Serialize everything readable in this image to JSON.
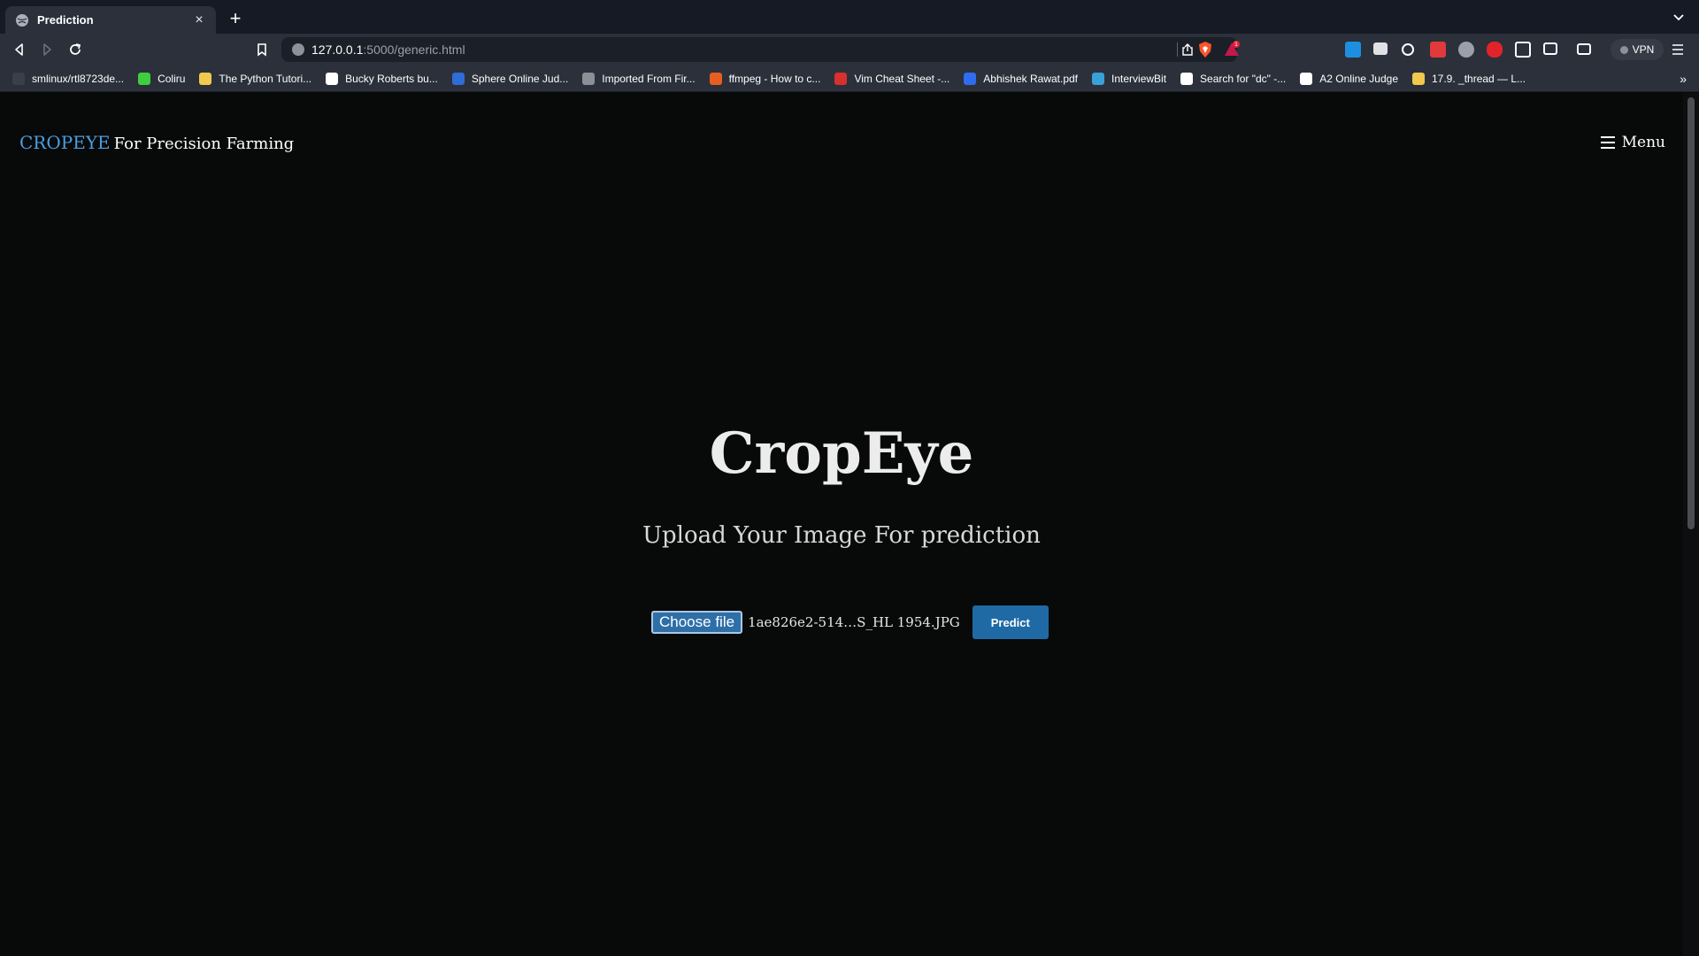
{
  "browser": {
    "tab": {
      "title": "Prediction",
      "favicon": "globe-icon",
      "close_glyph": "×"
    },
    "new_tab_glyph": "+",
    "url": {
      "host": "127.0.0.1",
      "path": ":5000/generic.html"
    },
    "vpn_label": "VPN",
    "bookmarks": [
      {
        "label": "smlinux/rtl8723de...",
        "icon": "github-icon",
        "color": "#3a3f48"
      },
      {
        "label": "Coliru",
        "icon": "coliru-icon",
        "color": "#3ecf3e"
      },
      {
        "label": "The Python Tutori...",
        "icon": "python-icon",
        "color": "#f2c94c"
      },
      {
        "label": "Bucky Roberts bu...",
        "icon": "github-icon",
        "color": "#ffffff"
      },
      {
        "label": "Sphere Online Jud...",
        "icon": "spoj-icon",
        "color": "#2f6cd6"
      },
      {
        "label": "Imported From Fir...",
        "icon": "folder-icon",
        "color": "#8c8f96"
      },
      {
        "label": "ffmpeg - How to c...",
        "icon": "askubuntu-icon",
        "color": "#e85d22"
      },
      {
        "label": "Vim Cheat Sheet -...",
        "icon": "vim-icon",
        "color": "#d92f2f"
      },
      {
        "label": "Abhishek Rawat.pdf",
        "icon": "dropbox-icon",
        "color": "#2f6cf0"
      },
      {
        "label": "InterviewBit",
        "icon": "interviewbit-icon",
        "color": "#3aa0d8"
      },
      {
        "label": "Search for \"dc\" -...",
        "icon": "barcode-icon",
        "color": "#ffffff"
      },
      {
        "label": "A2 Online Judge",
        "icon": "a2-icon",
        "color": "#ffffff"
      },
      {
        "label": "17.9. _thread — L...",
        "icon": "python-icon",
        "color": "#f2c94c"
      }
    ],
    "bookmarks_overflow_glyph": "»"
  },
  "site": {
    "brand_name": "CROPEYE",
    "brand_tagline": "For Precision Farming",
    "menu_label": "Menu",
    "title": "CropEye",
    "subtitle": "Upload Your Image For prediction",
    "choose_file_label": "Choose file",
    "file_name": "1ae826e2-514…S_HL 1954.JPG",
    "predict_label": "Predict"
  }
}
